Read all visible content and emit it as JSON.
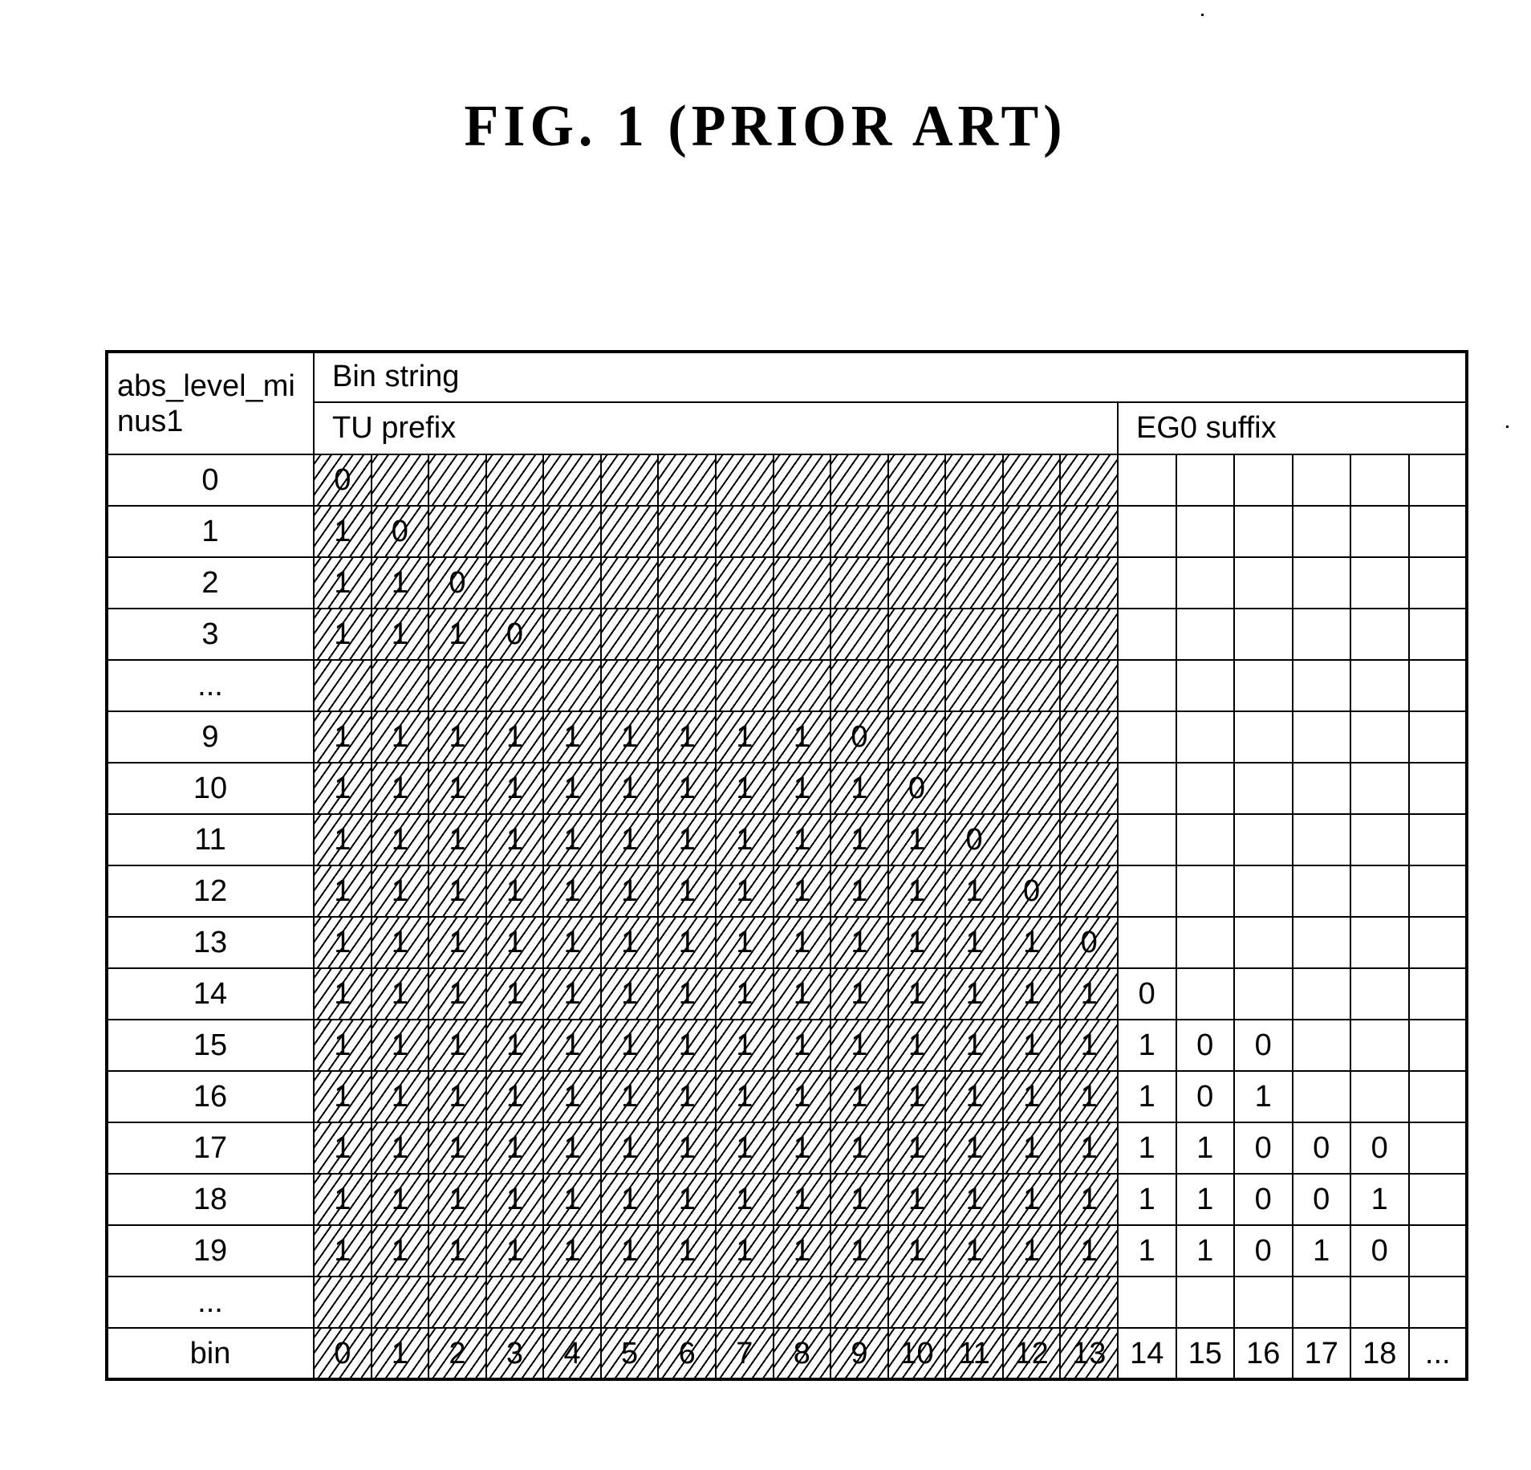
{
  "figure": {
    "title": "FIG. 1 (PRIOR ART)"
  },
  "table": {
    "row_header": "abs_level_mi\nnus1",
    "bin_string_label": "Bin string",
    "tu_prefix_label": "TU prefix",
    "eg0_suffix_label": "EG0 suffix",
    "tu_columns": 14,
    "suffix_columns": 6,
    "rows": [
      {
        "label": "0",
        "tu": [
          "0"
        ],
        "suffix": []
      },
      {
        "label": "1",
        "tu": [
          "1",
          "0"
        ],
        "suffix": []
      },
      {
        "label": "2",
        "tu": [
          "1",
          "1",
          "0"
        ],
        "suffix": []
      },
      {
        "label": "3",
        "tu": [
          "1",
          "1",
          "1",
          "0"
        ],
        "suffix": []
      },
      {
        "label": "...",
        "tu": [],
        "suffix": []
      },
      {
        "label": "9",
        "tu": [
          "1",
          "1",
          "1",
          "1",
          "1",
          "1",
          "1",
          "1",
          "1",
          "0"
        ],
        "suffix": []
      },
      {
        "label": "10",
        "tu": [
          "1",
          "1",
          "1",
          "1",
          "1",
          "1",
          "1",
          "1",
          "1",
          "1",
          "0"
        ],
        "suffix": []
      },
      {
        "label": "11",
        "tu": [
          "1",
          "1",
          "1",
          "1",
          "1",
          "1",
          "1",
          "1",
          "1",
          "1",
          "1",
          "0"
        ],
        "suffix": []
      },
      {
        "label": "12",
        "tu": [
          "1",
          "1",
          "1",
          "1",
          "1",
          "1",
          "1",
          "1",
          "1",
          "1",
          "1",
          "1",
          "0"
        ],
        "suffix": []
      },
      {
        "label": "13",
        "tu": [
          "1",
          "1",
          "1",
          "1",
          "1",
          "1",
          "1",
          "1",
          "1",
          "1",
          "1",
          "1",
          "1",
          "0"
        ],
        "suffix": []
      },
      {
        "label": "14",
        "tu": [
          "1",
          "1",
          "1",
          "1",
          "1",
          "1",
          "1",
          "1",
          "1",
          "1",
          "1",
          "1",
          "1",
          "1"
        ],
        "suffix": [
          "0"
        ]
      },
      {
        "label": "15",
        "tu": [
          "1",
          "1",
          "1",
          "1",
          "1",
          "1",
          "1",
          "1",
          "1",
          "1",
          "1",
          "1",
          "1",
          "1"
        ],
        "suffix": [
          "1",
          "0",
          "0"
        ]
      },
      {
        "label": "16",
        "tu": [
          "1",
          "1",
          "1",
          "1",
          "1",
          "1",
          "1",
          "1",
          "1",
          "1",
          "1",
          "1",
          "1",
          "1"
        ],
        "suffix": [
          "1",
          "0",
          "1"
        ]
      },
      {
        "label": "17",
        "tu": [
          "1",
          "1",
          "1",
          "1",
          "1",
          "1",
          "1",
          "1",
          "1",
          "1",
          "1",
          "1",
          "1",
          "1"
        ],
        "suffix": [
          "1",
          "1",
          "0",
          "0",
          "0"
        ]
      },
      {
        "label": "18",
        "tu": [
          "1",
          "1",
          "1",
          "1",
          "1",
          "1",
          "1",
          "1",
          "1",
          "1",
          "1",
          "1",
          "1",
          "1"
        ],
        "suffix": [
          "1",
          "1",
          "0",
          "0",
          "1"
        ]
      },
      {
        "label": "19",
        "tu": [
          "1",
          "1",
          "1",
          "1",
          "1",
          "1",
          "1",
          "1",
          "1",
          "1",
          "1",
          "1",
          "1",
          "1"
        ],
        "suffix": [
          "1",
          "1",
          "0",
          "1",
          "0"
        ]
      },
      {
        "label": "...",
        "tu": [],
        "suffix": []
      },
      {
        "label": "bin",
        "tu": [
          "0",
          "1",
          "2",
          "3",
          "4",
          "5",
          "6",
          "7",
          "8",
          "9",
          "10",
          "11",
          "12",
          "13"
        ],
        "suffix": [
          "14",
          "15",
          "16",
          "17",
          "18",
          "..."
        ]
      }
    ]
  }
}
